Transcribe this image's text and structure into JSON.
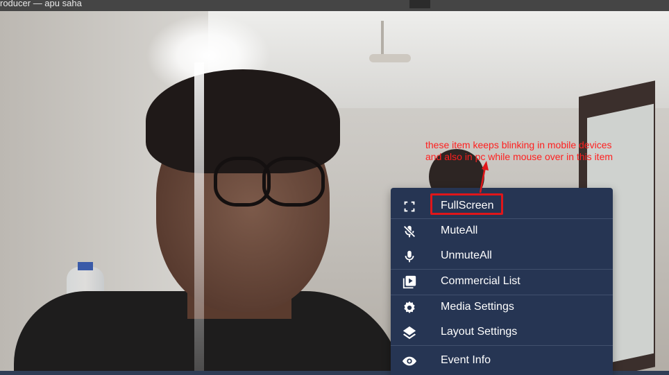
{
  "window": {
    "title": "roducer — apu saha"
  },
  "menu": {
    "items": [
      {
        "label": "FullScreen",
        "icon": "fullscreen-icon"
      },
      {
        "label": "MuteAll",
        "icon": "mic-off-icon"
      },
      {
        "label": "UnmuteAll",
        "icon": "mic-icon"
      },
      {
        "label": "Commercial List",
        "icon": "video-library-icon"
      },
      {
        "label": "Media Settings",
        "icon": "gear-icon"
      },
      {
        "label": "Layout Settings",
        "icon": "layers-icon"
      },
      {
        "label": "Event Info",
        "icon": "eye-icon"
      }
    ]
  },
  "annotation": {
    "line1": "these item keeps blinking in mobile devices",
    "line2": "and also in pc while mouse over in this item",
    "color": "#ff1f1f"
  },
  "colors": {
    "menu_bg": "#263553",
    "menu_divider": "#41506d",
    "highlight": "#e0161a"
  }
}
